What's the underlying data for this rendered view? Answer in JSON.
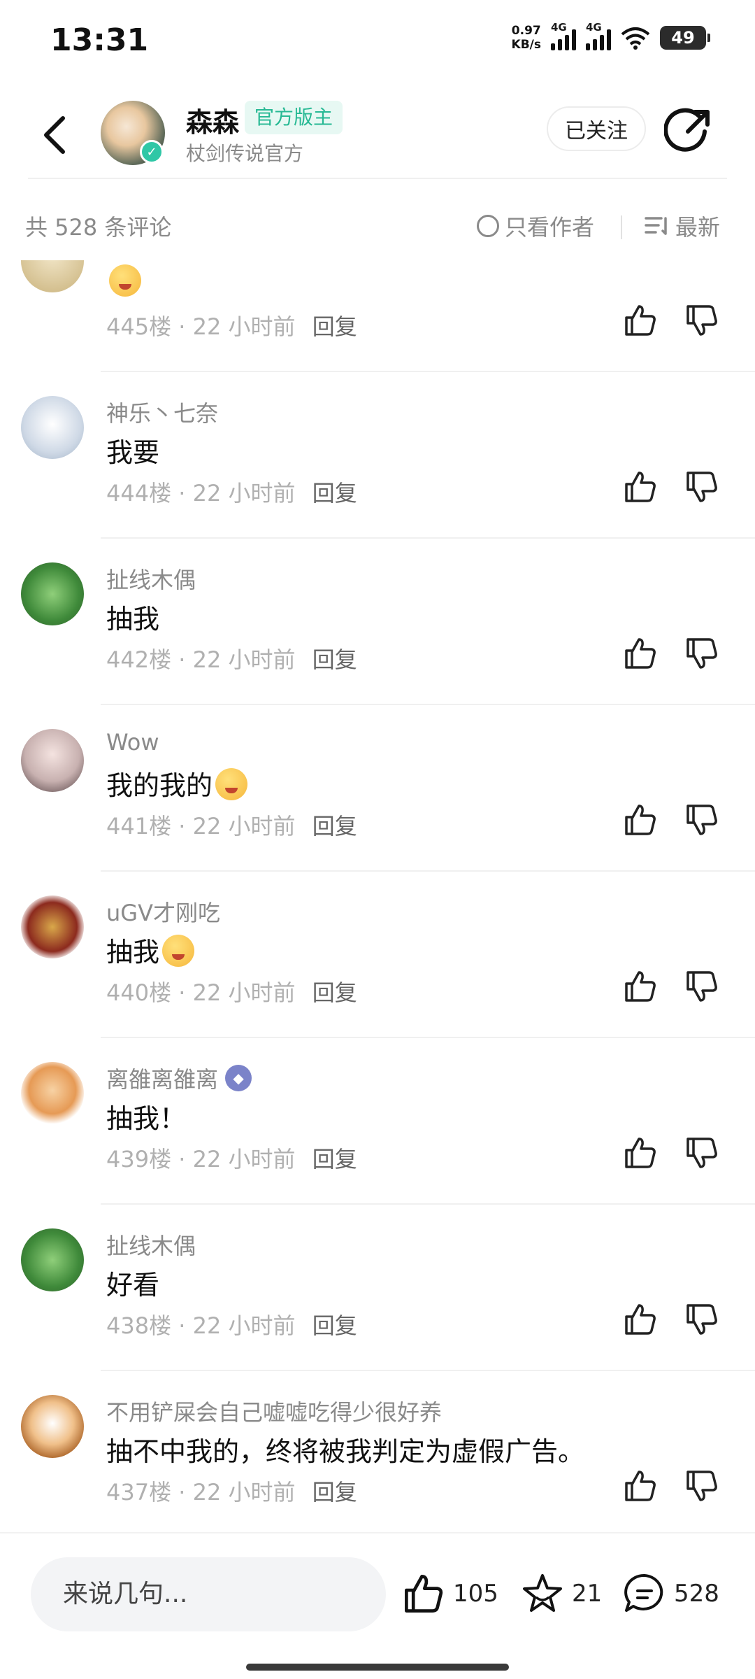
{
  "status_bar": {
    "time": "13:31",
    "net_speed_value": "0.97",
    "net_speed_unit": "KB/s",
    "signal1_label": "4G",
    "signal2_label": "4G",
    "battery_level": "49"
  },
  "header": {
    "author_name": "森森",
    "role_badge": "官方版主",
    "author_subtitle": "杖剑传说官方",
    "follow_label": "已关注"
  },
  "toolbar": {
    "comment_count": "共 528 条评论",
    "only_author_label": "只看作者",
    "sort_label": "最新"
  },
  "comments": [
    {
      "name": "",
      "text": "",
      "floor": "445楼",
      "time": "22 小时前",
      "reply": "回复"
    },
    {
      "name": "神乐丶七奈",
      "text": "我要",
      "floor": "444楼",
      "time": "22 小时前",
      "reply": "回复"
    },
    {
      "name": "扯线木偶",
      "text": "抽我",
      "floor": "442楼",
      "time": "22 小时前",
      "reply": "回复"
    },
    {
      "name": "Wow",
      "text": "我的我的",
      "floor": "441楼",
      "time": "22 小时前",
      "reply": "回复"
    },
    {
      "name": "uGV才刚吃",
      "text": "抽我",
      "floor": "440楼",
      "time": "22 小时前",
      "reply": "回复"
    },
    {
      "name": "离雒离雒离",
      "text": "抽我！",
      "floor": "439楼",
      "time": "22 小时前",
      "reply": "回复"
    },
    {
      "name": "扯线木偶",
      "text": "好看",
      "floor": "438楼",
      "time": "22 小时前",
      "reply": "回复"
    },
    {
      "name": "不用铲屎会自己嘘嘘吃得少很好养",
      "text": "抽不中我的，终将被我判定为虚假广告。",
      "floor": "437楼",
      "time": "22 小时前",
      "reply": "回复"
    }
  ],
  "bottom_bar": {
    "input_placeholder": "来说几句...",
    "like_count": "105",
    "favorite_count": "21",
    "comment_count": "528"
  },
  "colors": {
    "accent_green": "#27b994",
    "badge_bg": "#e7f8f3",
    "muted_text": "#8a8a8a"
  }
}
